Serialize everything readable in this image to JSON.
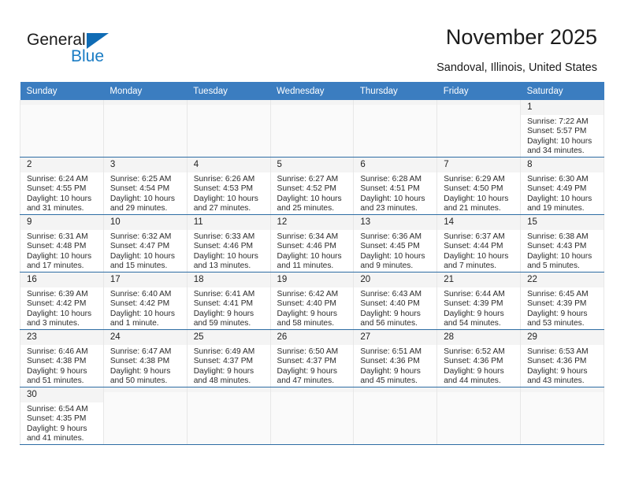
{
  "brand": {
    "name_top": "General",
    "name_bottom": "Blue",
    "accent_color": "#1a7cc4",
    "triangle_color": "#106cb5"
  },
  "header": {
    "title": "November 2025",
    "location": "Sandoval, Illinois, United States"
  },
  "calendar": {
    "header_bg": "#3b7dc0",
    "weekdays": [
      "Sunday",
      "Monday",
      "Tuesday",
      "Wednesday",
      "Thursday",
      "Friday",
      "Saturday"
    ],
    "weeks": [
      [
        {
          "day": "",
          "empty": true
        },
        {
          "day": "",
          "empty": true
        },
        {
          "day": "",
          "empty": true
        },
        {
          "day": "",
          "empty": true
        },
        {
          "day": "",
          "empty": true
        },
        {
          "day": "",
          "empty": true
        },
        {
          "day": "1",
          "sunrise": "Sunrise: 7:22 AM",
          "sunset": "Sunset: 5:57 PM",
          "daylight": "Daylight: 10 hours and 34 minutes."
        }
      ],
      [
        {
          "day": "2",
          "sunrise": "Sunrise: 6:24 AM",
          "sunset": "Sunset: 4:55 PM",
          "daylight": "Daylight: 10 hours and 31 minutes."
        },
        {
          "day": "3",
          "sunrise": "Sunrise: 6:25 AM",
          "sunset": "Sunset: 4:54 PM",
          "daylight": "Daylight: 10 hours and 29 minutes."
        },
        {
          "day": "4",
          "sunrise": "Sunrise: 6:26 AM",
          "sunset": "Sunset: 4:53 PM",
          "daylight": "Daylight: 10 hours and 27 minutes."
        },
        {
          "day": "5",
          "sunrise": "Sunrise: 6:27 AM",
          "sunset": "Sunset: 4:52 PM",
          "daylight": "Daylight: 10 hours and 25 minutes."
        },
        {
          "day": "6",
          "sunrise": "Sunrise: 6:28 AM",
          "sunset": "Sunset: 4:51 PM",
          "daylight": "Daylight: 10 hours and 23 minutes."
        },
        {
          "day": "7",
          "sunrise": "Sunrise: 6:29 AM",
          "sunset": "Sunset: 4:50 PM",
          "daylight": "Daylight: 10 hours and 21 minutes."
        },
        {
          "day": "8",
          "sunrise": "Sunrise: 6:30 AM",
          "sunset": "Sunset: 4:49 PM",
          "daylight": "Daylight: 10 hours and 19 minutes."
        }
      ],
      [
        {
          "day": "9",
          "sunrise": "Sunrise: 6:31 AM",
          "sunset": "Sunset: 4:48 PM",
          "daylight": "Daylight: 10 hours and 17 minutes."
        },
        {
          "day": "10",
          "sunrise": "Sunrise: 6:32 AM",
          "sunset": "Sunset: 4:47 PM",
          "daylight": "Daylight: 10 hours and 15 minutes."
        },
        {
          "day": "11",
          "sunrise": "Sunrise: 6:33 AM",
          "sunset": "Sunset: 4:46 PM",
          "daylight": "Daylight: 10 hours and 13 minutes."
        },
        {
          "day": "12",
          "sunrise": "Sunrise: 6:34 AM",
          "sunset": "Sunset: 4:46 PM",
          "daylight": "Daylight: 10 hours and 11 minutes."
        },
        {
          "day": "13",
          "sunrise": "Sunrise: 6:36 AM",
          "sunset": "Sunset: 4:45 PM",
          "daylight": "Daylight: 10 hours and 9 minutes."
        },
        {
          "day": "14",
          "sunrise": "Sunrise: 6:37 AM",
          "sunset": "Sunset: 4:44 PM",
          "daylight": "Daylight: 10 hours and 7 minutes."
        },
        {
          "day": "15",
          "sunrise": "Sunrise: 6:38 AM",
          "sunset": "Sunset: 4:43 PM",
          "daylight": "Daylight: 10 hours and 5 minutes."
        }
      ],
      [
        {
          "day": "16",
          "sunrise": "Sunrise: 6:39 AM",
          "sunset": "Sunset: 4:42 PM",
          "daylight": "Daylight: 10 hours and 3 minutes."
        },
        {
          "day": "17",
          "sunrise": "Sunrise: 6:40 AM",
          "sunset": "Sunset: 4:42 PM",
          "daylight": "Daylight: 10 hours and 1 minute."
        },
        {
          "day": "18",
          "sunrise": "Sunrise: 6:41 AM",
          "sunset": "Sunset: 4:41 PM",
          "daylight": "Daylight: 9 hours and 59 minutes."
        },
        {
          "day": "19",
          "sunrise": "Sunrise: 6:42 AM",
          "sunset": "Sunset: 4:40 PM",
          "daylight": "Daylight: 9 hours and 58 minutes."
        },
        {
          "day": "20",
          "sunrise": "Sunrise: 6:43 AM",
          "sunset": "Sunset: 4:40 PM",
          "daylight": "Daylight: 9 hours and 56 minutes."
        },
        {
          "day": "21",
          "sunrise": "Sunrise: 6:44 AM",
          "sunset": "Sunset: 4:39 PM",
          "daylight": "Daylight: 9 hours and 54 minutes."
        },
        {
          "day": "22",
          "sunrise": "Sunrise: 6:45 AM",
          "sunset": "Sunset: 4:39 PM",
          "daylight": "Daylight: 9 hours and 53 minutes."
        }
      ],
      [
        {
          "day": "23",
          "sunrise": "Sunrise: 6:46 AM",
          "sunset": "Sunset: 4:38 PM",
          "daylight": "Daylight: 9 hours and 51 minutes."
        },
        {
          "day": "24",
          "sunrise": "Sunrise: 6:47 AM",
          "sunset": "Sunset: 4:38 PM",
          "daylight": "Daylight: 9 hours and 50 minutes."
        },
        {
          "day": "25",
          "sunrise": "Sunrise: 6:49 AM",
          "sunset": "Sunset: 4:37 PM",
          "daylight": "Daylight: 9 hours and 48 minutes."
        },
        {
          "day": "26",
          "sunrise": "Sunrise: 6:50 AM",
          "sunset": "Sunset: 4:37 PM",
          "daylight": "Daylight: 9 hours and 47 minutes."
        },
        {
          "day": "27",
          "sunrise": "Sunrise: 6:51 AM",
          "sunset": "Sunset: 4:36 PM",
          "daylight": "Daylight: 9 hours and 45 minutes."
        },
        {
          "day": "28",
          "sunrise": "Sunrise: 6:52 AM",
          "sunset": "Sunset: 4:36 PM",
          "daylight": "Daylight: 9 hours and 44 minutes."
        },
        {
          "day": "29",
          "sunrise": "Sunrise: 6:53 AM",
          "sunset": "Sunset: 4:36 PM",
          "daylight": "Daylight: 9 hours and 43 minutes."
        }
      ],
      [
        {
          "day": "30",
          "sunrise": "Sunrise: 6:54 AM",
          "sunset": "Sunset: 4:35 PM",
          "daylight": "Daylight: 9 hours and 41 minutes."
        },
        {
          "day": "",
          "empty": true
        },
        {
          "day": "",
          "empty": true
        },
        {
          "day": "",
          "empty": true
        },
        {
          "day": "",
          "empty": true
        },
        {
          "day": "",
          "empty": true
        },
        {
          "day": "",
          "empty": true
        }
      ]
    ]
  }
}
